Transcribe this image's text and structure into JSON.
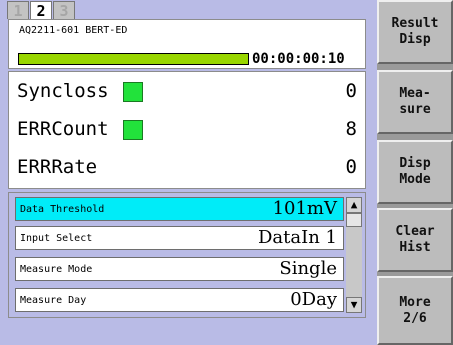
{
  "tabs": [
    "1",
    "2",
    "3"
  ],
  "active_tab": "2",
  "header": {
    "title": "AQ2211-601 BERT-ED",
    "elapsed_time": "00:00:00:10",
    "progress_percent": 100
  },
  "results": [
    {
      "label": "Syncloss",
      "value": "0",
      "indicator_color": "#22e23b"
    },
    {
      "label": "ERRCount",
      "value": "8",
      "indicator_color": "#22e23b"
    },
    {
      "label": "ERRRate",
      "value": "0"
    }
  ],
  "parameters": [
    {
      "label": "Data Threshold",
      "value": "101mV",
      "selected": true
    },
    {
      "label": "Input Select",
      "value": "DataIn 1"
    },
    {
      "label": "Measure Mode",
      "value": "Single"
    },
    {
      "label": "Measure Day",
      "value": "0Day"
    }
  ],
  "softkeys": [
    {
      "line1": "Result",
      "line2": "Disp"
    },
    {
      "line1": "Mea-",
      "line2": "sure"
    },
    {
      "line1": "Disp",
      "line2": "Mode"
    },
    {
      "line1": "Clear",
      "line2": "Hist"
    },
    {
      "line1": "More",
      "line2": "2/6"
    }
  ],
  "colors": {
    "background": "#b9bbe6",
    "selected_row": "#00ecf8",
    "progress": "#99d600",
    "status_led": "#22e23b"
  },
  "icons": {
    "scroll_up": "triangle-up-icon",
    "scroll_down": "triangle-down-icon"
  }
}
